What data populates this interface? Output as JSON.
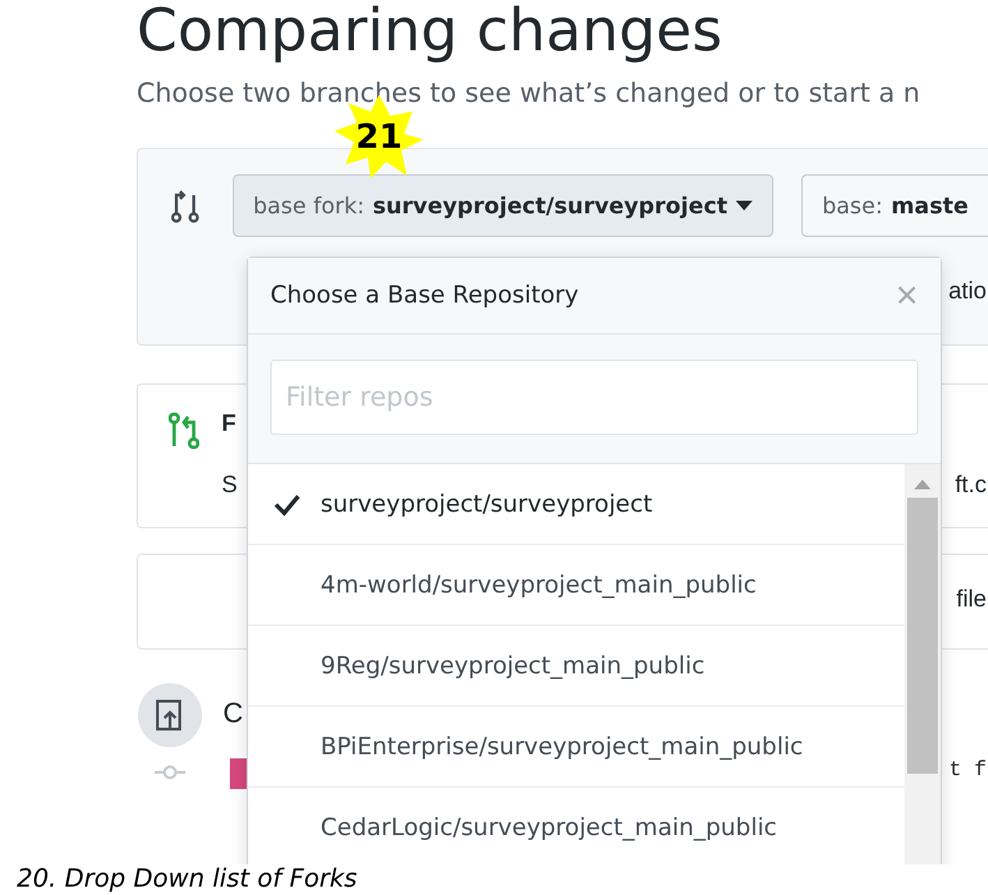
{
  "page": {
    "title": "Comparing changes",
    "subtitle": "Choose two branches to see what’s changed or to start a n"
  },
  "compare": {
    "base_fork": {
      "label": "base fork:",
      "value": "surveyproject/surveyproject"
    },
    "base": {
      "label": "base:",
      "value": "maste"
    },
    "note_fragment": "atio"
  },
  "pull_request_card": {
    "heading": "F",
    "text": "S",
    "fragment": "ft.c"
  },
  "files_card": {
    "fragment": "file"
  },
  "commits": {
    "heading": "C",
    "fragment": "t f"
  },
  "dropdown": {
    "title": "Choose a Base Repository",
    "close": "×",
    "filter": {
      "placeholder": "Filter repos"
    },
    "repos": [
      {
        "name": "surveyproject/surveyproject",
        "selected": true
      },
      {
        "name": "4m-world/surveyproject_main_public",
        "selected": false
      },
      {
        "name": "9Reg/surveyproject_main_public",
        "selected": false
      },
      {
        "name": "BPiEnterprise/surveyproject_main_public",
        "selected": false
      },
      {
        "name": "CedarLogic/surveyproject_main_public",
        "selected": false
      }
    ]
  },
  "callout": {
    "number": "21"
  },
  "caption": "20. Drop Down list of Forks"
}
